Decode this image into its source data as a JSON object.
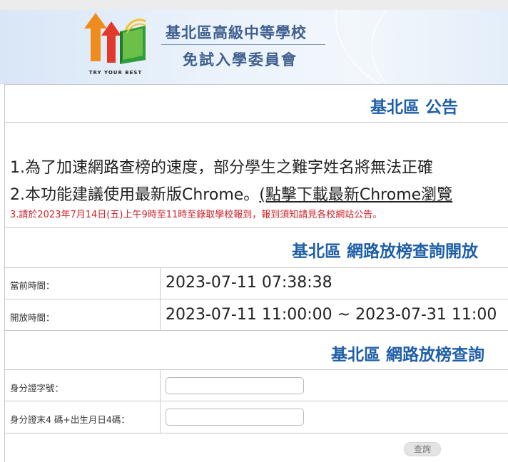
{
  "header": {
    "logo_caption": "TRY YOUR BEST",
    "title_line1": "基北區高級中等學校",
    "title_line2": "免試入學委員會"
  },
  "announcement": {
    "heading": "基北區 公告",
    "line1": "1.為了加速網路查榜的速度，部分學生之難字姓名將無法正確",
    "line2_prefix": "2.本功能建議使用最新版Chrome。",
    "line2_link": "(點擊下載最新Chrome瀏覽",
    "line3": "3.請於2023年7月14日(五)上午9時至11時至錄取學校報到，報到須知請見各校網站公告。"
  },
  "open_period": {
    "heading": "基北區 網路放榜查詢開放",
    "current_time_label": "當前時間：",
    "current_time_value": "2023-07-11 07:38:38",
    "open_time_label": "開放時間：",
    "open_time_value": "2023-07-11 11:00:00 ~ 2023-07-31 11:00"
  },
  "query": {
    "heading": "基北區 網路放榜查詢",
    "id_label": "身分證字號：",
    "id_value": "",
    "combo_label": "身分證末4 碼+出生月日4碼：",
    "combo_value": "",
    "submit_label": "查詢"
  },
  "colors": {
    "heading_blue": "#1f5fa8",
    "title_blue": "#3f5f8f",
    "notice_red": "#d0202a"
  }
}
